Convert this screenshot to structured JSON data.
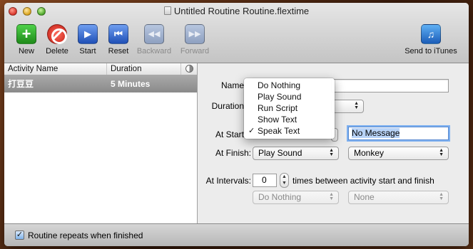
{
  "window": {
    "title": "Untitled Routine Routine.flextime"
  },
  "toolbar": {
    "new": "New",
    "delete": "Delete",
    "start": "Start",
    "reset": "Reset",
    "backward": "Backward",
    "forward": "Forward",
    "send_to_itunes": "Send to iTunes"
  },
  "table": {
    "headers": [
      "Activity Name",
      "Duration"
    ],
    "rows": [
      {
        "name": "打豆豆",
        "duration": "5 Minutes"
      }
    ]
  },
  "form": {
    "name_label": "Name",
    "duration_label": "Duration",
    "at_start_label": "At Start",
    "at_start_message": "No Message",
    "at_finish_label": "At Finish:",
    "at_finish_action": "Play Sound",
    "at_finish_sound": "Monkey",
    "at_intervals_label": "At Intervals:",
    "intervals_count": "0",
    "intervals_text": "times between activity start and finish",
    "intervals_action": "Do Nothing",
    "intervals_option": "None"
  },
  "action_menu": {
    "items": [
      "Do Nothing",
      "Play Sound",
      "Run Script",
      "Show Text",
      "Speak Text"
    ],
    "selected": "Speak Text",
    "check": "✓"
  },
  "footer": {
    "repeat_label": "Routine repeats when finished",
    "repeat_checked": true
  }
}
